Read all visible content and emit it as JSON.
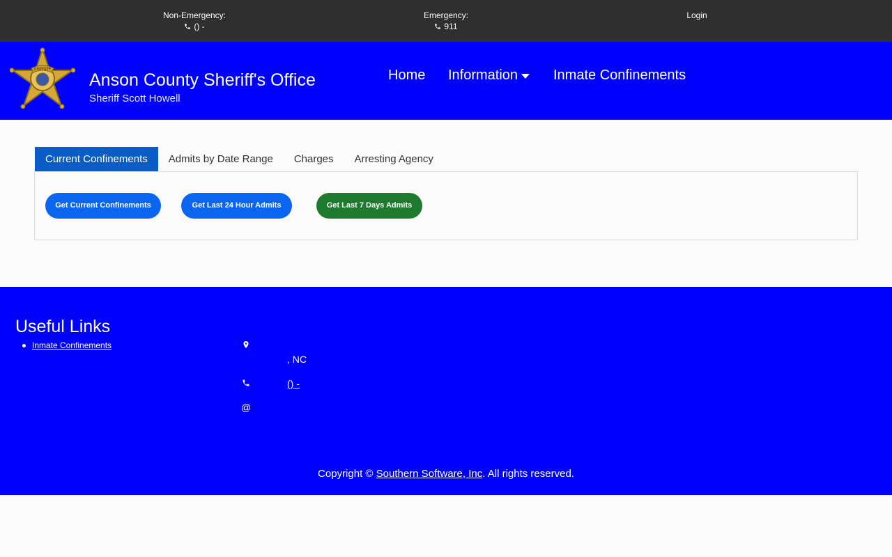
{
  "topbar": {
    "non_emergency_label": "Non-Emergency:",
    "non_emergency_phone": "() -",
    "emergency_label": "Emergency:",
    "emergency_phone": "911",
    "login": "Login"
  },
  "header": {
    "title": "Anson County Sheriff's Office",
    "subtitle": "Sheriff Scott Howell",
    "badge_text": "SHERIFF",
    "nav": {
      "home": "Home",
      "information": "Information",
      "inmate_confinements": "Inmate Confinements"
    }
  },
  "tabs": [
    {
      "label": "Current Confinements",
      "active": true
    },
    {
      "label": "Admits by Date Range",
      "active": false
    },
    {
      "label": "Charges",
      "active": false
    },
    {
      "label": "Arresting Agency",
      "active": false
    }
  ],
  "buttons": {
    "current": "Get Current Confinements",
    "last24": "Get Last 24 Hour Admits",
    "last7": "Get Last 7 Days Admits"
  },
  "footer": {
    "useful_links_title": "Useful Links",
    "useful_links": [
      "Inmate Confinements"
    ],
    "address_state": ", NC",
    "phone": "() -",
    "email_symbol": "@",
    "copyright_prefix": "Copyright © ",
    "copyright_company": "Southern Software, Inc",
    "copyright_suffix": ". All rights reserved."
  },
  "colors": {
    "topbar_bg": "#2f2f2f",
    "brand_blue": "#0000ff",
    "tab_active": "#0a5cc7",
    "button_blue": "#0a66f0",
    "button_green": "#1e7a2e",
    "badge_gold": "#d4a838"
  }
}
